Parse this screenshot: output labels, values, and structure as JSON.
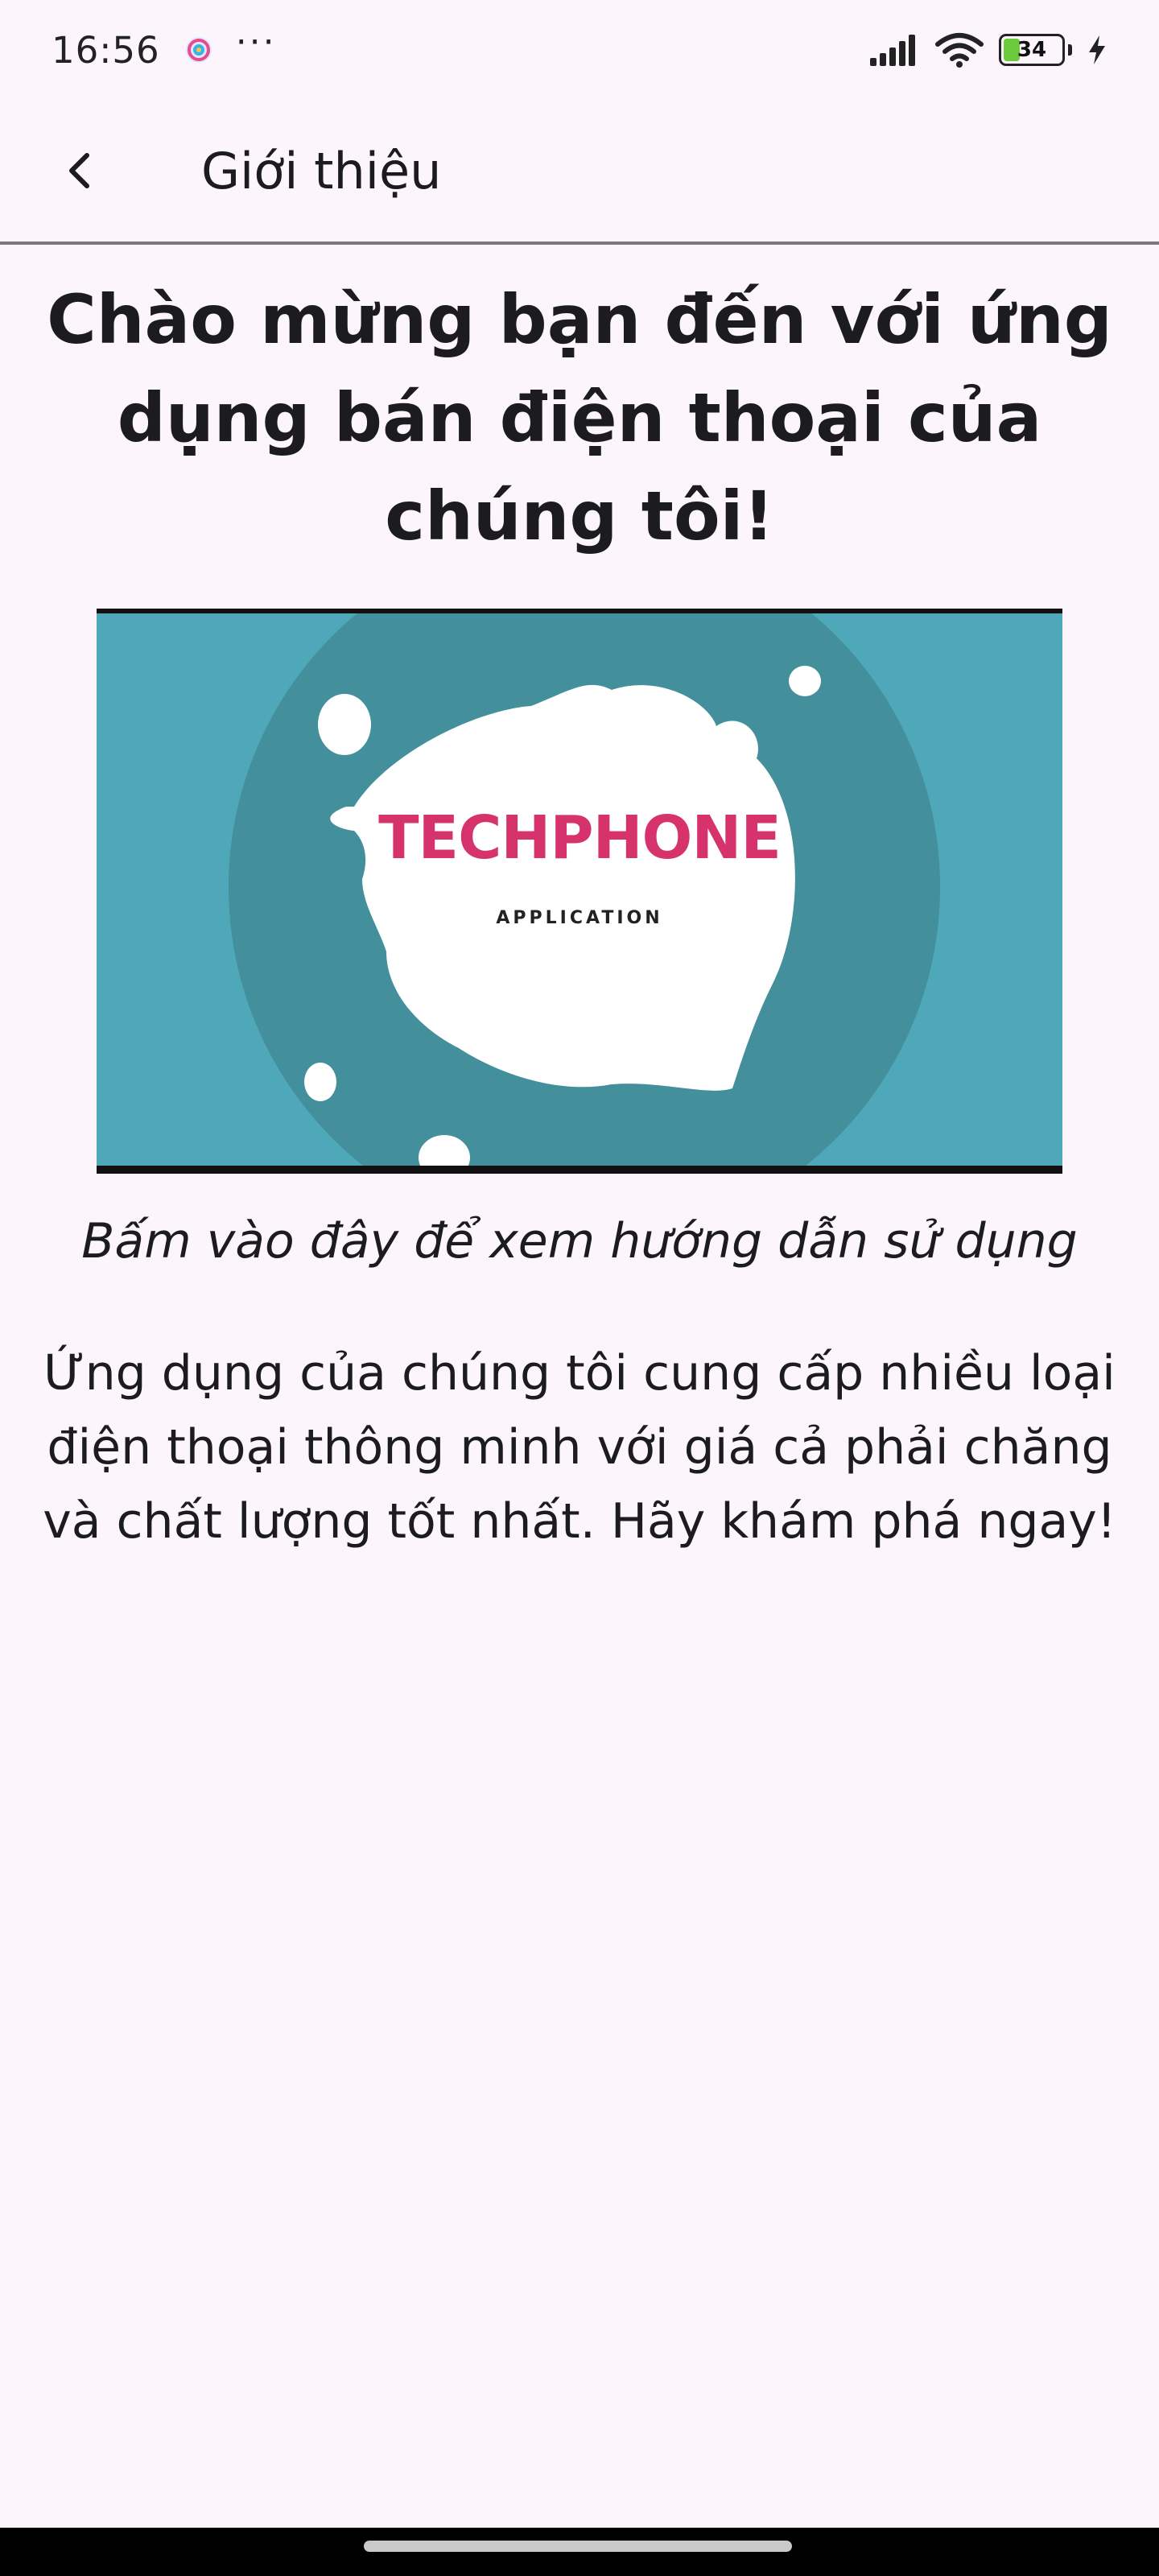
{
  "status_bar": {
    "time": "16:56",
    "more": "···",
    "battery_level": "34",
    "battery_fraction": 0.34,
    "charging": true
  },
  "app_bar": {
    "title": "Giới thiệu",
    "back_icon": "chevron-left-icon"
  },
  "content": {
    "headline": "Chào mừng bạn đến với ứng dụng bán điện thoại của chúng tôi!",
    "banner": {
      "brand": "TECHPHONE",
      "subtitle": "APPLICATION",
      "background_color": "#4FA8B9",
      "circle_color": "#438F9C",
      "brand_color": "#D6336C"
    },
    "guide_link": "Bấm vào đây để xem hướng dẫn sử dụng",
    "description": "Ứng dụng của chúng tôi cung cấp nhiều loại điện thoại thông minh với giá cả phải chăng và chất lượng tốt nhất. Hãy khám phá ngay!"
  },
  "theme": {
    "background": "#FCF6FC",
    "text": "#1C1B1F",
    "divider": "#7A777D"
  }
}
